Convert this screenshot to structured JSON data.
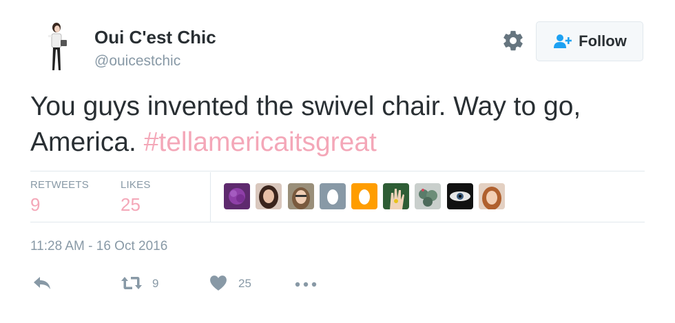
{
  "user": {
    "name": "Oui C'est Chic",
    "handle": "@ouicestchic"
  },
  "follow_button": {
    "label": "Follow"
  },
  "tweet": {
    "text": "You guys invented the swivel chair. Way to go, America.",
    "hashtag": "#tellamericaitsgreat"
  },
  "stats": {
    "retweets_label": "RETWEETS",
    "retweets_value": "9",
    "likes_label": "LIKES",
    "likes_value": "25"
  },
  "likers": [
    {
      "icon": "purple-flower-avatar",
      "color": "#7b2d8f"
    },
    {
      "icon": "woman-avatar",
      "color": "#8a5a4a"
    },
    {
      "icon": "woman-glasses-avatar",
      "color": "#b88d6a"
    },
    {
      "icon": "egg-avatar",
      "color": "#8899a6"
    },
    {
      "icon": "egg-avatar",
      "color": "#ff9d00"
    },
    {
      "icon": "hand-avatar",
      "color": "#2e5d35"
    },
    {
      "icon": "cactus-avatar",
      "color": "#7a8f8a"
    },
    {
      "icon": "eye-avatar",
      "color": "#222222"
    },
    {
      "icon": "redhead-woman-avatar",
      "color": "#c98a5e"
    }
  ],
  "timestamp": "11:28 AM - 16 Oct 2016",
  "actions": {
    "retweet_count": "9",
    "like_count": "25"
  },
  "colors": {
    "accent_pink": "#f4a7b8",
    "follow_blue": "#1da1f2",
    "muted_gray": "#8899a6"
  }
}
